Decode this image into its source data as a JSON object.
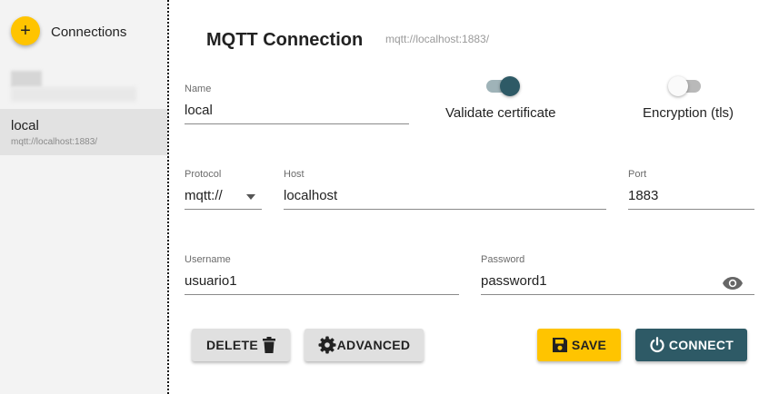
{
  "sidebar": {
    "add_icon": "+",
    "title": "Connections",
    "connections": [
      {
        "name": "local",
        "url": "mqtt://localhost:1883/"
      }
    ]
  },
  "header": {
    "title": "MQTT Connection",
    "url": "mqtt://localhost:1883/"
  },
  "form": {
    "name": {
      "label": "Name",
      "value": "local"
    },
    "validate_certificate": {
      "label": "Validate certificate",
      "checked": true
    },
    "encryption": {
      "label": "Encryption (tls)",
      "checked": false
    },
    "protocol": {
      "label": "Protocol",
      "value": "mqtt://"
    },
    "host": {
      "label": "Host",
      "value": "localhost"
    },
    "port": {
      "label": "Port",
      "value": "1883"
    },
    "username": {
      "label": "Username",
      "value": "usuario1"
    },
    "password": {
      "label": "Password",
      "value": "password1",
      "icon": "eye-icon"
    }
  },
  "buttons": {
    "delete": {
      "label": "DELETE",
      "icon": "trash-icon"
    },
    "advanced": {
      "label": "ADVANCED",
      "icon": "gear-icon"
    },
    "save": {
      "label": "SAVE",
      "icon": "floppy-disk-icon"
    },
    "connect": {
      "label": "CONNECT",
      "icon": "power-icon"
    }
  },
  "colors": {
    "accent_yellow": "#ffc400",
    "primary_teal": "#2e5a66",
    "toggle_on_track": "#9fb3b8",
    "toggle_off_track": "#b9b9b9"
  }
}
